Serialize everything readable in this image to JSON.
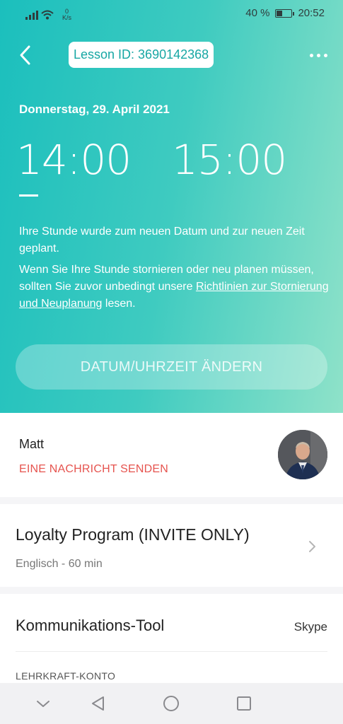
{
  "status_bar": {
    "net_speed_value": "0",
    "net_speed_unit": "K/s",
    "battery_percent": "40 %",
    "battery_level": 0.4,
    "time": "20:52"
  },
  "header": {
    "lesson_id": "Lesson ID: 3690142368"
  },
  "lesson": {
    "date": "Donnerstag, 29. April 2021",
    "start_time": "14:00",
    "end_time": "15:00",
    "info_scheduled": "Ihre Stunde wurde zum neuen Datum und zur neuen Zeit geplant.",
    "info_cancel_prefix": "Wenn Sie Ihre Stunde stornieren oder neu planen müssen, sollten Sie zuvor unbedingt unsere ",
    "info_cancel_link": "Richtlinien zur Stornierung und Neuplanung",
    "info_cancel_suffix": " lesen.",
    "change_button": "DATUM/UHRZEIT ÄNDERN"
  },
  "teacher": {
    "name": "Matt",
    "message_link": "EINE NACHRICHT SENDEN"
  },
  "course": {
    "title": "Loyalty Program (INVITE ONLY)",
    "subtitle": "Englisch - 60 min"
  },
  "communication": {
    "label": "Kommunikations-Tool",
    "value": "Skype",
    "account_label": "LEHRKRAFT-KONTO"
  },
  "colors": {
    "accent_teal": "#1bbfbd",
    "accent_mint": "#8fe2c9",
    "message_red": "#e6544f"
  }
}
